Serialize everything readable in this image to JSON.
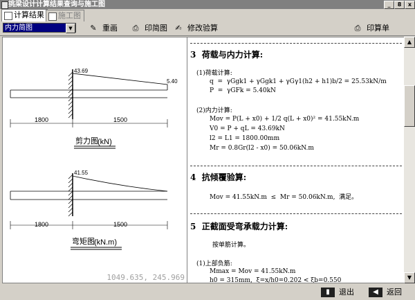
{
  "window": {
    "title": "挑梁设计计算结果查询与施工图",
    "btn_min": "_",
    "btn_max": "8",
    "btn_close": "x"
  },
  "tabs": [
    {
      "label": "计算结果"
    },
    {
      "label": "施工图"
    }
  ],
  "toolbar": {
    "select_value": "内力简图",
    "redraw": "重画",
    "print_graph": "印简图",
    "modify": "修改验算",
    "print_sheet": "印算单"
  },
  "diagrams": {
    "shear": {
      "left_value": "43.69",
      "right_value": "5.40",
      "dim_left": "1800",
      "dim_right": "1500",
      "label_text": "剪力图",
      "label_unit": "(kN)"
    },
    "moment": {
      "left_value": "41.55",
      "dim_left": "1800",
      "dim_right": "1500",
      "label_text": "弯矩图",
      "label_unit": "(kN.m)"
    }
  },
  "coords": "1049.635,  245.969",
  "report": {
    "s3_title": "3  荷载与内力计算:",
    "load_title": "(1)荷载计算:",
    "load_lines": [
      "q  =  γGgk1 + γGgk1 + γGγ1(h2 + h1)b/2 = 25.53kN/m",
      "P  =  γGFk = 5.40kN"
    ],
    "force_title": "(2)内力计算:",
    "force_lines": [
      "Mov = P(L + x0) + 1/2 q(L + x0)² = 41.55kN.m",
      "V0 = P + qL = 43.69kN",
      "l2 = L1 = 1800.00mm",
      "Mr = 0.8Gr(l2 - x0) = 50.06kN.m"
    ],
    "s4_title": "4  抗倾覆验算:",
    "s4_line": "Mov = 41.55kN.m  ≤  Mr = 50.06kN.m,  满足。",
    "s5_title": "5  正截面受弯承载力计算:",
    "s5_sub": "按单筋计算。",
    "s5_top_title": "(1)上部负筋:",
    "s5_lines": [
      "Mmax = Mov = 41.55kN.m",
      "h0 = 315mm,  ξ=x/h0=0.202 < ξb=0.550"
    ]
  },
  "bottom": {
    "exit": "退出",
    "back": "返回"
  }
}
